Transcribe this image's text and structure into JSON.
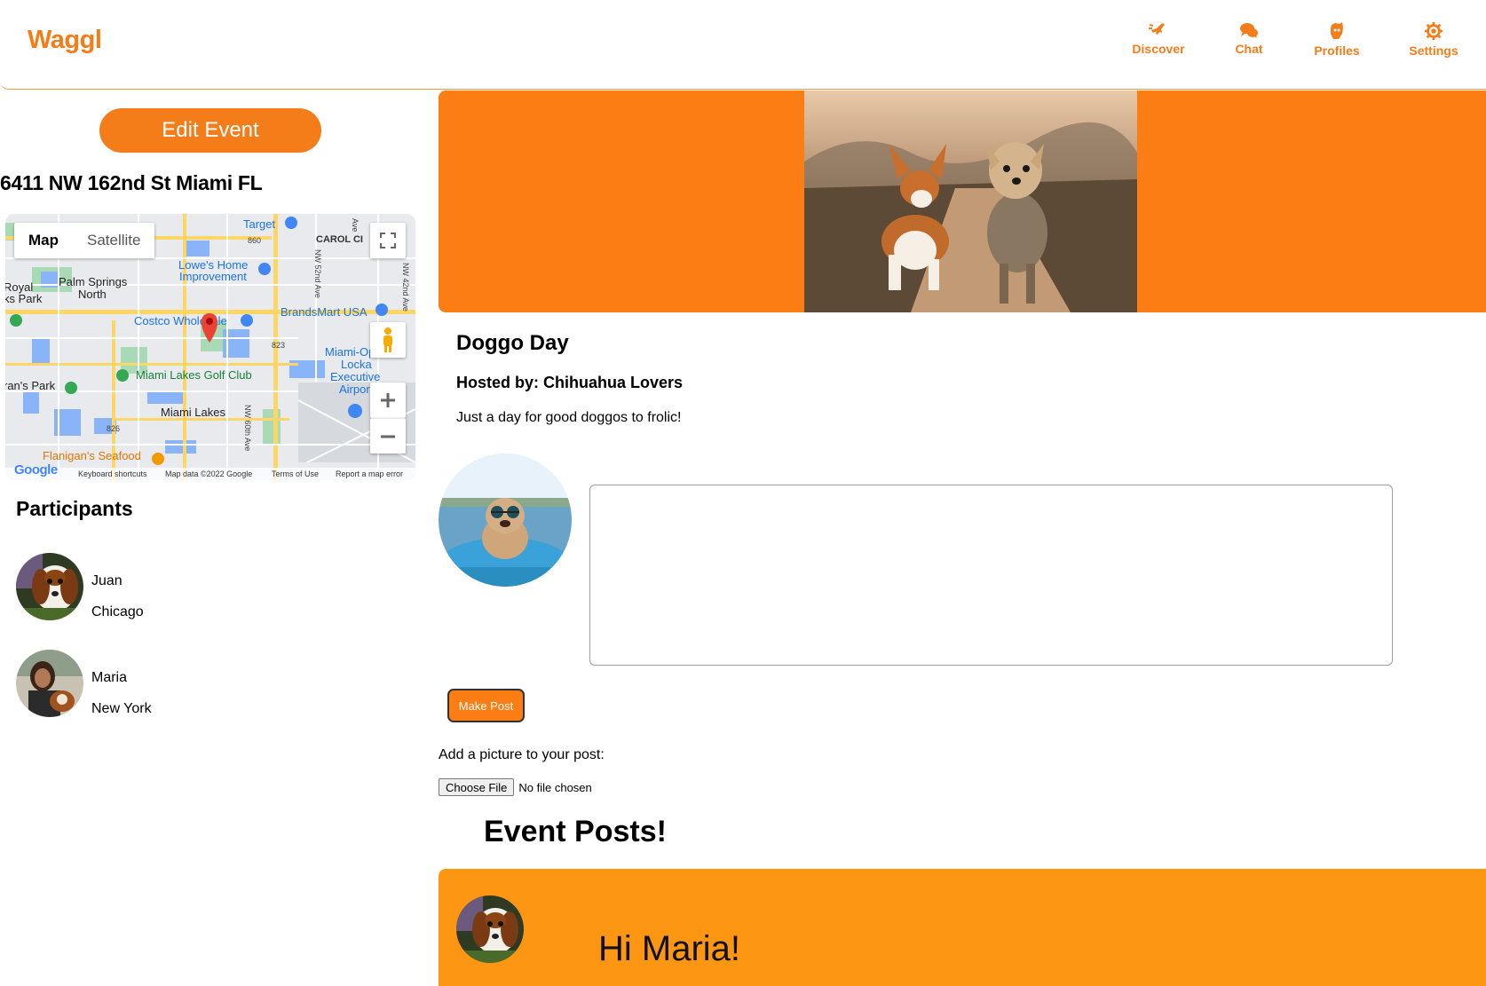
{
  "app": {
    "name": "Waggl"
  },
  "nav": [
    {
      "label": "Discover",
      "icon": "dog-running-icon"
    },
    {
      "label": "Chat",
      "icon": "chat-bubbles-icon"
    },
    {
      "label": "Profiles",
      "icon": "dog-head-icon"
    },
    {
      "label": "Settings",
      "icon": "gear-icon"
    }
  ],
  "colors": {
    "accent": "#f47d1a",
    "banner": "#fb7d13",
    "post_card": "#fd9713"
  },
  "event": {
    "edit_label": "Edit Event",
    "address": "6411 NW 162nd St Miami FL",
    "title": "Doggo Day",
    "host": "Hosted by: Chihuahua Lovers",
    "description": "Just a day for good doggos to frolic!"
  },
  "map": {
    "tabs": [
      "Map",
      "Satellite"
    ],
    "active_tab": "Map",
    "labels": [
      "Target",
      "CAROL CI",
      "Lowe's Home",
      "Improvement",
      "Palm Springs",
      "North",
      "Royal",
      "ks Park",
      "Costco Wholesale",
      "BrandsMart USA",
      "Miami-Opa",
      "Locka",
      "Executive",
      "Airport",
      "Miami Lakes Golf Club",
      "ran's Park",
      "Miami Lakes",
      "Flanigan's Seafood",
      "860",
      "823",
      "826",
      "NW 52nd Ave",
      "NW 60th Ave",
      "NW 42nd Ave",
      "Ave"
    ],
    "footer": [
      "Keyboard shortcuts",
      "Map data ©2022 Google",
      "Terms of Use",
      "Report a map error"
    ],
    "logo": "Google"
  },
  "participants": {
    "title": "Participants",
    "items": [
      {
        "name": "Juan",
        "city": "Chicago"
      },
      {
        "name": "Maria",
        "city": "New York"
      }
    ]
  },
  "composer": {
    "placeholder": "",
    "make_post_label": "Make Post",
    "add_picture_label": "Add a picture to your post:",
    "choose_file_label": "Choose File",
    "no_file_label": "No file chosen"
  },
  "posts": {
    "title": "Event Posts!",
    "items": [
      {
        "text": "Hi Maria!"
      }
    ]
  }
}
